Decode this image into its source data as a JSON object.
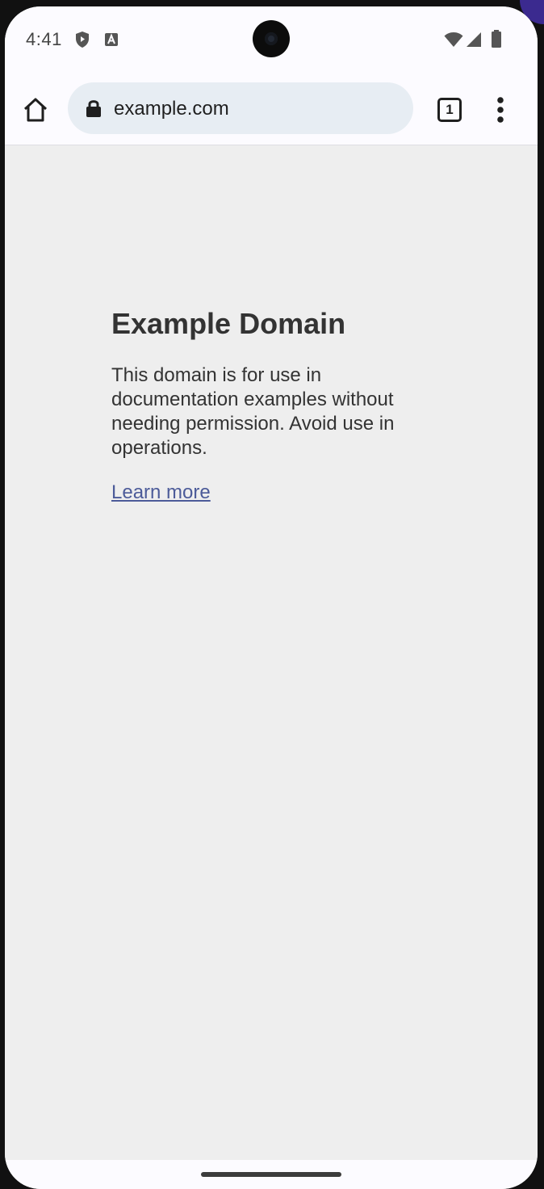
{
  "status_bar": {
    "time": "4:41",
    "icons": [
      "shield-icon",
      "font-a-icon",
      "wifi-icon",
      "signal-icon",
      "battery-icon"
    ]
  },
  "toolbar": {
    "url": "example.com",
    "tab_count": "1",
    "icons": [
      "home-icon",
      "lock-icon",
      "more-vert-icon"
    ]
  },
  "page": {
    "title": "Example Domain",
    "body": "This domain is for use in documentation examples without needing permission. Avoid use in operations.",
    "link_text": "Learn more",
    "colors": {
      "background": "#eeeeee",
      "text": "#333333",
      "link": "#4c5b99"
    }
  }
}
